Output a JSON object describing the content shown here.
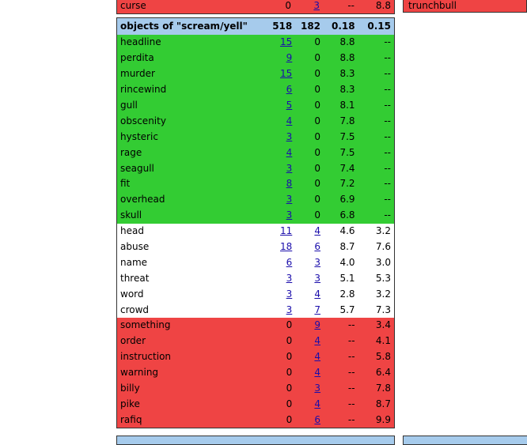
{
  "top_row": {
    "word": "curse",
    "c1": "0",
    "c2": "3",
    "s1": "--",
    "s2": "8.8"
  },
  "side_label": "trunchbull",
  "header": {
    "label": "objects of \"scream/yell\"",
    "c1": "518",
    "c2": "182",
    "s1": "0.18",
    "s2": "0.15"
  },
  "rows": [
    {
      "word": "headline",
      "c1": "15",
      "c2": "0",
      "s1": "8.8",
      "s2": "--",
      "color": "green"
    },
    {
      "word": "perdita",
      "c1": "9",
      "c2": "0",
      "s1": "8.8",
      "s2": "--",
      "color": "green"
    },
    {
      "word": "murder",
      "c1": "15",
      "c2": "0",
      "s1": "8.3",
      "s2": "--",
      "color": "green"
    },
    {
      "word": "rincewind",
      "c1": "6",
      "c2": "0",
      "s1": "8.3",
      "s2": "--",
      "color": "green"
    },
    {
      "word": "gull",
      "c1": "5",
      "c2": "0",
      "s1": "8.1",
      "s2": "--",
      "color": "green"
    },
    {
      "word": "obscenity",
      "c1": "4",
      "c2": "0",
      "s1": "7.8",
      "s2": "--",
      "color": "green"
    },
    {
      "word": "hysteric",
      "c1": "3",
      "c2": "0",
      "s1": "7.5",
      "s2": "--",
      "color": "green"
    },
    {
      "word": "rage",
      "c1": "4",
      "c2": "0",
      "s1": "7.5",
      "s2": "--",
      "color": "green"
    },
    {
      "word": "seagull",
      "c1": "3",
      "c2": "0",
      "s1": "7.4",
      "s2": "--",
      "color": "green"
    },
    {
      "word": "fit",
      "c1": "8",
      "c2": "0",
      "s1": "7.2",
      "s2": "--",
      "color": "green"
    },
    {
      "word": "overhead",
      "c1": "3",
      "c2": "0",
      "s1": "6.9",
      "s2": "--",
      "color": "green"
    },
    {
      "word": "skull",
      "c1": "3",
      "c2": "0",
      "s1": "6.8",
      "s2": "--",
      "color": "green"
    },
    {
      "word": "head",
      "c1": "11",
      "c2": "4",
      "s1": "4.6",
      "s2": "3.2",
      "color": "white"
    },
    {
      "word": "abuse",
      "c1": "18",
      "c2": "6",
      "s1": "8.7",
      "s2": "7.6",
      "color": "white"
    },
    {
      "word": "name",
      "c1": "6",
      "c2": "3",
      "s1": "4.0",
      "s2": "3.0",
      "color": "white"
    },
    {
      "word": "threat",
      "c1": "3",
      "c2": "3",
      "s1": "5.1",
      "s2": "5.3",
      "color": "white"
    },
    {
      "word": "word",
      "c1": "3",
      "c2": "4",
      "s1": "2.8",
      "s2": "3.2",
      "color": "white"
    },
    {
      "word": "crowd",
      "c1": "3",
      "c2": "7",
      "s1": "5.7",
      "s2": "7.3",
      "color": "white"
    },
    {
      "word": "something",
      "c1": "0",
      "c2": "9",
      "s1": "--",
      "s2": "3.4",
      "color": "red"
    },
    {
      "word": "order",
      "c1": "0",
      "c2": "4",
      "s1": "--",
      "s2": "4.1",
      "color": "red"
    },
    {
      "word": "instruction",
      "c1": "0",
      "c2": "4",
      "s1": "--",
      "s2": "5.8",
      "color": "red"
    },
    {
      "word": "warning",
      "c1": "0",
      "c2": "4",
      "s1": "--",
      "s2": "6.4",
      "color": "red"
    },
    {
      "word": "billy",
      "c1": "0",
      "c2": "3",
      "s1": "--",
      "s2": "7.8",
      "color": "red"
    },
    {
      "word": "pike",
      "c1": "0",
      "c2": "4",
      "s1": "--",
      "s2": "8.7",
      "color": "red"
    },
    {
      "word": "rafiq",
      "c1": "0",
      "c2": "6",
      "s1": "--",
      "s2": "9.9",
      "color": "red"
    }
  ],
  "colors": {
    "green": "#33cc33",
    "red": "#ef4444",
    "header": "#a6cbec",
    "link": "#1a0dab"
  }
}
